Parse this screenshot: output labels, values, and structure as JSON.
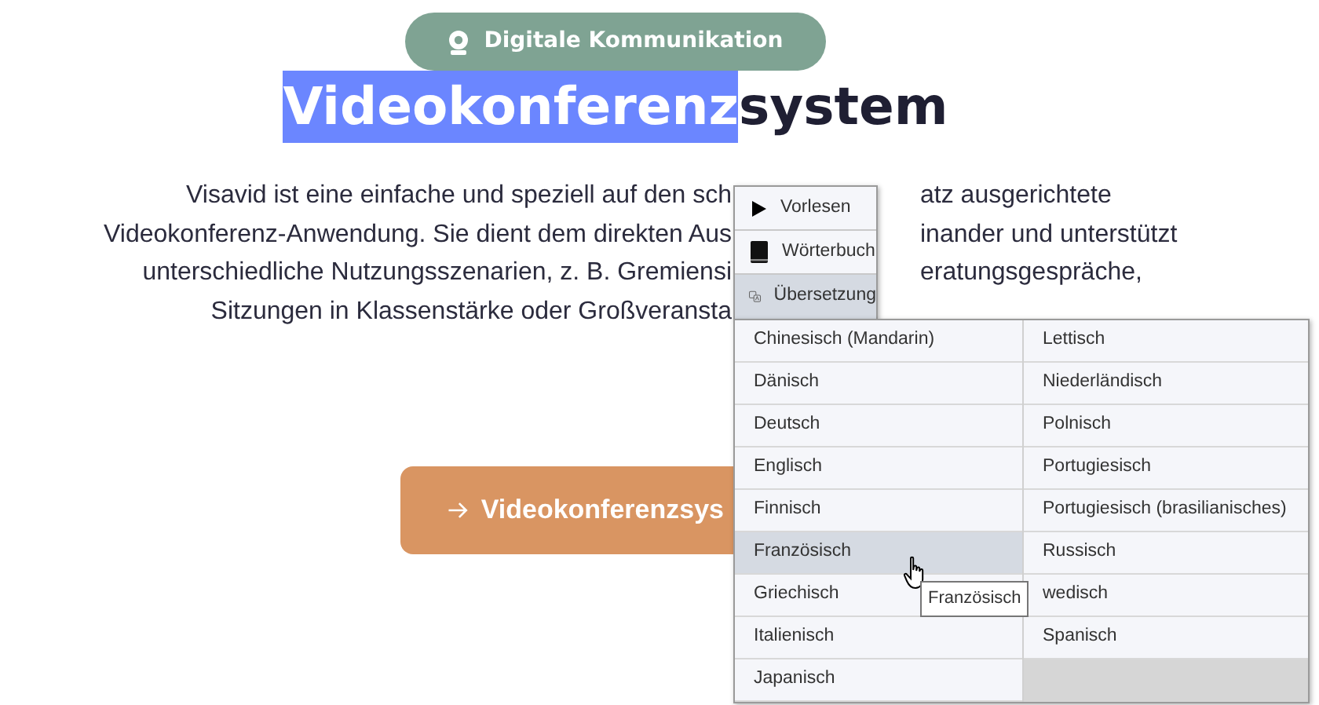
{
  "badge": {
    "text": "Digitale Kommunikation"
  },
  "title": [
    {
      "text": "Videokonferenz",
      "selected": true
    },
    {
      "text": "system",
      "selected": false
    }
  ],
  "paragraph_lines": [
    {
      "left": "Visavid ist eine einfache und speziell auf den sch",
      "right": "atz ausgerichtete"
    },
    {
      "left": "Videokonferenz-Anwendung. Sie dient dem direkten Aus",
      "right": "inander und unterstützt"
    },
    {
      "left": "unterschiedliche Nutzungsszenarien, z. B. Gremiensi",
      "right": "eratungsgespräche,"
    },
    {
      "left": "Sitzungen in Klassenstärke oder Großveransta"
    }
  ],
  "cta_button": {
    "text": "Videokonferenzsys"
  },
  "context_menu": {
    "items": [
      {
        "kind": "read-aloud",
        "label": "Vorlesen",
        "selected": false
      },
      {
        "kind": "dictionary",
        "label": "Wörterbuch",
        "selected": false
      },
      {
        "kind": "translation",
        "label": "Übersetzung",
        "selected": true
      }
    ]
  },
  "language_menu": {
    "columns": [
      [
        {
          "label": "Chinesisch (Mandarin)",
          "selected": false
        },
        {
          "label": "Dänisch",
          "selected": false
        },
        {
          "label": "Deutsch",
          "selected": false
        },
        {
          "label": "Englisch",
          "selected": false
        },
        {
          "label": "Finnisch",
          "selected": false
        },
        {
          "label": "Französisch",
          "selected": true
        },
        {
          "label": "Griechisch",
          "selected": false
        },
        {
          "label": "Italienisch",
          "selected": false
        },
        {
          "label": "Japanisch",
          "selected": false
        }
      ],
      [
        {
          "label": "Lettisch",
          "selected": false
        },
        {
          "label": "Niederländisch",
          "selected": false
        },
        {
          "label": "Polnisch",
          "selected": false
        },
        {
          "label": "Portugiesisch",
          "selected": false
        },
        {
          "label": "Portugiesisch (brasilianisches)",
          "selected": false
        },
        {
          "label": "Russisch",
          "selected": false
        },
        {
          "label": "wedisch",
          "selected": false
        },
        {
          "label": "Spanisch",
          "selected": false
        }
      ]
    ]
  },
  "tooltip": {
    "text": "Französisch"
  }
}
